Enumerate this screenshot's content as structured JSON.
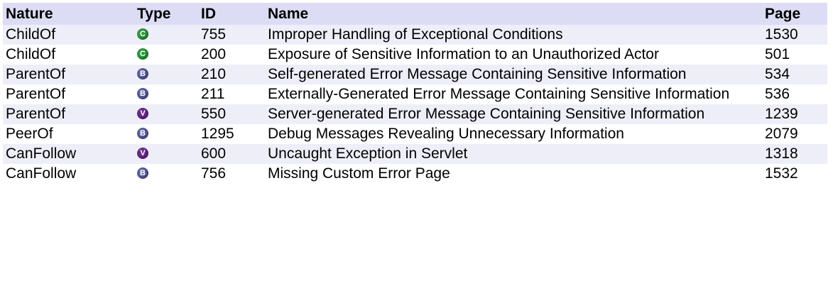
{
  "headers": {
    "nature": "Nature",
    "type": "Type",
    "id": "ID",
    "name": "Name",
    "page": "Page"
  },
  "badge_colors": {
    "C": "#2e9b3e",
    "B": "#5b5f9e",
    "V": "#6a2a8c"
  },
  "rows": [
    {
      "nature": "ChildOf",
      "type": "C",
      "id": "755",
      "name": "Improper Handling of Exceptional Conditions",
      "page": "1530"
    },
    {
      "nature": "ChildOf",
      "type": "C",
      "id": "200",
      "name": "Exposure of Sensitive Information to an Unauthorized Actor",
      "page": "501"
    },
    {
      "nature": "ParentOf",
      "type": "B",
      "id": "210",
      "name": "Self-generated Error Message Containing Sensitive Information",
      "page": "534"
    },
    {
      "nature": "ParentOf",
      "type": "B",
      "id": "211",
      "name": "Externally-Generated Error Message Containing Sensitive Information",
      "page": "536"
    },
    {
      "nature": "ParentOf",
      "type": "V",
      "id": "550",
      "name": "Server-generated Error Message Containing Sensitive Information",
      "page": "1239"
    },
    {
      "nature": "PeerOf",
      "type": "B",
      "id": "1295",
      "name": "Debug Messages Revealing Unnecessary Information",
      "page": "2079"
    },
    {
      "nature": "CanFollow",
      "type": "V",
      "id": "600",
      "name": "Uncaught Exception in Servlet",
      "page": "1318"
    },
    {
      "nature": "CanFollow",
      "type": "B",
      "id": "756",
      "name": "Missing Custom Error Page",
      "page": "1532"
    }
  ]
}
